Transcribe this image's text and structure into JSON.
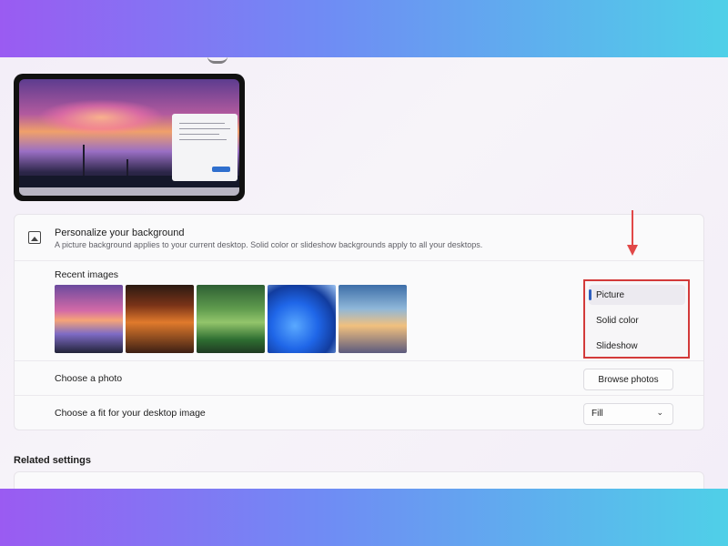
{
  "background": {
    "title": "Personalize your background",
    "description": "A picture background applies to your current desktop. Solid color or slideshow backgrounds apply to all your desktops.",
    "type_options": [
      "Picture",
      "Solid color",
      "Slideshow"
    ],
    "selected_type": "Picture"
  },
  "recent_images": {
    "label": "Recent images",
    "items": [
      "sunset-city",
      "lantern-night",
      "forest-cottage",
      "windows-bloom",
      "sky-ship"
    ]
  },
  "choose_photo": {
    "label": "Choose a photo",
    "button_label": "Browse photos"
  },
  "fit": {
    "label": "Choose a fit for your desktop image",
    "value": "Fill"
  },
  "related": {
    "title": "Related settings"
  },
  "colors": {
    "highlight_border": "#d33a3a",
    "arrow": "#e14848",
    "accent": "#2f5fbf"
  }
}
